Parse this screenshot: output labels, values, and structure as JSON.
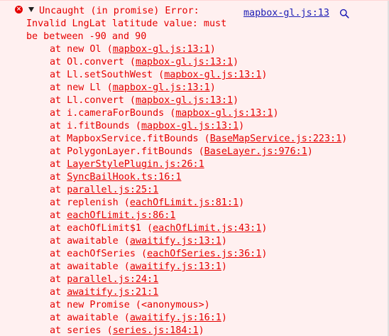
{
  "error": {
    "icon": "error-circle-icon",
    "icon_glyph": "×",
    "message_lines": [
      "Uncaught (in promise) Error:",
      "Invalid LngLat latitude value: must",
      "be between -90 and 90"
    ],
    "source_link": "mapbox-gl.js:13",
    "search_icon": "magnifier-icon"
  },
  "frames": [
    {
      "prefix": "at new Ol (",
      "link": "mapbox-gl.js:13:1",
      "suffix": ")"
    },
    {
      "prefix": "at Ol.convert (",
      "link": "mapbox-gl.js:13:1",
      "suffix": ")"
    },
    {
      "prefix": "at Ll.setSouthWest (",
      "link": "mapbox-gl.js:13:1",
      "suffix": ")"
    },
    {
      "prefix": "at new Ll (",
      "link": "mapbox-gl.js:13:1",
      "suffix": ")"
    },
    {
      "prefix": "at Ll.convert (",
      "link": "mapbox-gl.js:13:1",
      "suffix": ")"
    },
    {
      "prefix": "at i.cameraForBounds (",
      "link": "mapbox-gl.js:13:1",
      "suffix": ")"
    },
    {
      "prefix": "at i.fitBounds (",
      "link": "mapbox-gl.js:13:1",
      "suffix": ")"
    },
    {
      "prefix": "at MapboxService.fitBounds (",
      "link": "BaseMapService.js:223:1",
      "suffix": ")"
    },
    {
      "prefix": "at PolygonLayer.fitBounds (",
      "link": "BaseLayer.js:976:1",
      "suffix": ")"
    },
    {
      "prefix": "at ",
      "link": "LayerStylePlugin.js:26:1",
      "suffix": ""
    },
    {
      "prefix": "at ",
      "link": "SyncBailHook.ts:16:1",
      "suffix": ""
    },
    {
      "prefix": "at ",
      "link": "parallel.js:25:1",
      "suffix": ""
    },
    {
      "prefix": "at replenish (",
      "link": "eachOfLimit.js:81:1",
      "suffix": ")"
    },
    {
      "prefix": "at ",
      "link": "eachOfLimit.js:86:1",
      "suffix": ""
    },
    {
      "prefix": "at eachOfLimit$1 (",
      "link": "eachOfLimit.js:43:1",
      "suffix": ")"
    },
    {
      "prefix": "at awaitable (",
      "link": "awaitify.js:13:1",
      "suffix": ")"
    },
    {
      "prefix": "at eachOfSeries (",
      "link": "eachOfSeries.js:36:1",
      "suffix": ")"
    },
    {
      "prefix": "at awaitable (",
      "link": "awaitify.js:13:1",
      "suffix": ")"
    },
    {
      "prefix": "at ",
      "link": "parallel.js:24:1",
      "suffix": ""
    },
    {
      "prefix": "at ",
      "link": "awaitify.js:21:1",
      "suffix": ""
    },
    {
      "prefix": "at new Promise (<anonymous>)",
      "link": "",
      "suffix": ""
    },
    {
      "prefix": "at awaitable (",
      "link": "awaitify.js:16:1",
      "suffix": ")"
    },
    {
      "prefix": "at series (",
      "link": "series.js:184:1",
      "suffix": ")"
    }
  ],
  "colors": {
    "background": "#fff0f0",
    "error_text": "#e50000",
    "source_link": "#1a1ab4"
  }
}
